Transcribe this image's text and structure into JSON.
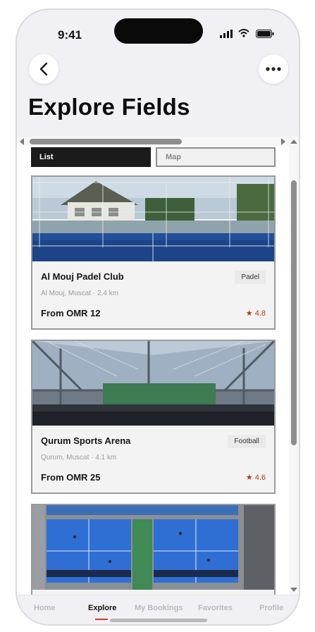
{
  "status_bar": {
    "time": "9:41"
  },
  "header": {
    "title": "Explore Fields"
  },
  "view_toggle": {
    "list_label": "List",
    "map_label": "Map",
    "selected": "List"
  },
  "fields": [
    {
      "name": "Al Mouj Padel Club",
      "sport": "Padel",
      "location": "Al Mouj, Muscat · 2.4 km",
      "price": "From OMR 12",
      "rating": "★ 4.8"
    },
    {
      "name": "Qurum Sports Arena",
      "sport": "Football",
      "location": "Qurum, Muscat · 4.1 km",
      "price": "From OMR 25",
      "rating": "★ 4.6"
    },
    {
      "name": "",
      "sport": "",
      "location": "",
      "price": "",
      "rating": ""
    }
  ],
  "tabs": [
    {
      "label": "Home"
    },
    {
      "label": "Explore"
    },
    {
      "label": "My Bookings"
    },
    {
      "label": "Favorites"
    },
    {
      "label": "Profile"
    }
  ],
  "active_tab": "Explore",
  "colors": {
    "accent": "#d9362b",
    "rating": "#b23a12",
    "dark": "#1b1b1b"
  }
}
